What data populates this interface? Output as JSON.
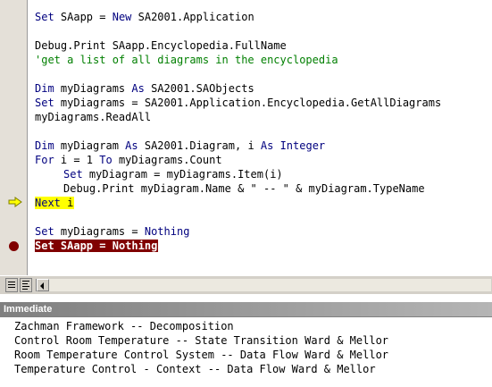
{
  "code_lines": [
    {
      "kw1": "Set",
      "t1": " SAapp = ",
      "kw2": "New",
      "t2": " SA2001.Application"
    },
    {
      "t1": "Debug.Print SAapp.Encyclopedia.FullName"
    },
    {
      "c": "'get a list of all diagrams in the encyclopedia"
    },
    {
      "kw1": "Dim",
      "t1": " myDiagrams ",
      "kw2": "As",
      "t2": " SA2001.SAObjects"
    },
    {
      "kw1": "Set",
      "t1": " myDiagrams = SA2001.Application.Encyclopedia.GetAllDiagrams"
    },
    {
      "t1": "myDiagrams.ReadAll"
    },
    {
      "kw1": "Dim",
      "t1": " myDiagram ",
      "kw2": "As",
      "t2": " SA2001.Diagram, i ",
      "kw3": "As",
      "kw4": " Integer"
    },
    {
      "kw1": "For",
      "t1": " i = 1 ",
      "kw2": "To",
      "t2": " myDiagrams.Count"
    },
    {
      "kw1": "Set",
      "t1": " myDiagram = myDiagrams.Item(i)"
    },
    {
      "t1": "Debug.Print myDiagram.Name & \" -- \" & myDiagram.TypeName"
    },
    {
      "kw1": "Next",
      "t1": " i"
    },
    {
      "kw1": "Set",
      "t1": " myDiagrams = ",
      "kw2": "Nothing"
    },
    {
      "kw1": "Set",
      "t1": " SAapp = ",
      "kw2": "Nothing"
    }
  ],
  "immediate": {
    "title": "Immediate",
    "output": [
      "Zachman Framework -- Decomposition",
      "Control Room Temperature -- State Transition Ward & Mellor",
      "Room Temperature Control System -- Data Flow Ward & Mellor",
      "Temperature Control - Context -- Data Flow Ward & Mellor"
    ]
  },
  "colors": {
    "keyword": "#00007f",
    "comment": "#007f00",
    "execution_highlight": "#ffff00",
    "breakpoint_highlight": "#800000",
    "margin": "#e4e0d8"
  },
  "icons": [
    "execution-arrow-icon",
    "breakpoint-icon",
    "procedure-view-icon",
    "full-module-view-icon",
    "scroll-left-arrow-icon"
  ]
}
